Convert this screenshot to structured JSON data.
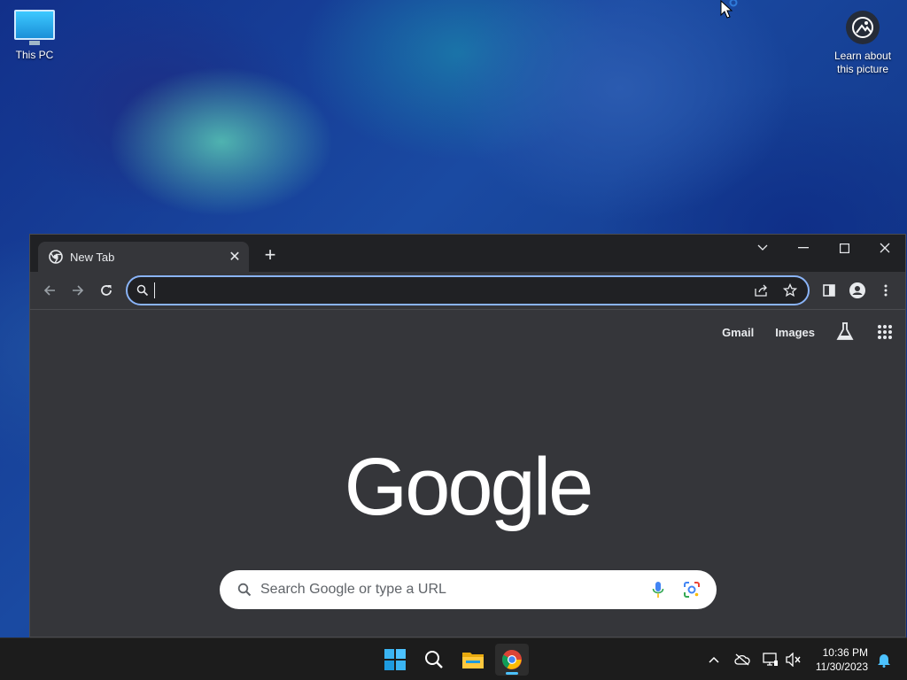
{
  "desktop": {
    "this_pc_label": "This PC",
    "learn_label_1": "Learn about",
    "learn_label_2": "this picture"
  },
  "browser": {
    "tab_title": "New Tab",
    "omnibox_value": "",
    "top_links": {
      "gmail": "Gmail",
      "images": "Images"
    },
    "logo_text": "Google",
    "search_placeholder": "Search Google or type a URL"
  },
  "taskbar": {
    "time": "10:36 PM",
    "date": "11/30/2023"
  },
  "colors": {
    "accent": "#8ab4f8",
    "taskbar_indicator": "#4cc2ff",
    "page_bg": "#35363a",
    "tab_strip": "#202124"
  },
  "icons": [
    "monitor-icon",
    "learn-about-picture-icon",
    "chrome-favicon-icon",
    "close-tab-icon",
    "new-tab-icon",
    "chevron-down-icon",
    "minimize-icon",
    "maximize-icon",
    "close-window-icon",
    "back-icon",
    "forward-icon",
    "reload-icon",
    "search-icon",
    "share-icon",
    "star-icon",
    "side-panel-icon",
    "profile-icon",
    "menu-icon",
    "labs-icon",
    "apps-icon",
    "voice-search-icon",
    "lens-icon",
    "windows-start-icon",
    "taskbar-search-icon",
    "file-explorer-icon",
    "chrome-taskbar-icon",
    "chevron-up-icon",
    "cloud-icon",
    "network-icon",
    "volume-muted-icon",
    "notification-bell-icon"
  ]
}
